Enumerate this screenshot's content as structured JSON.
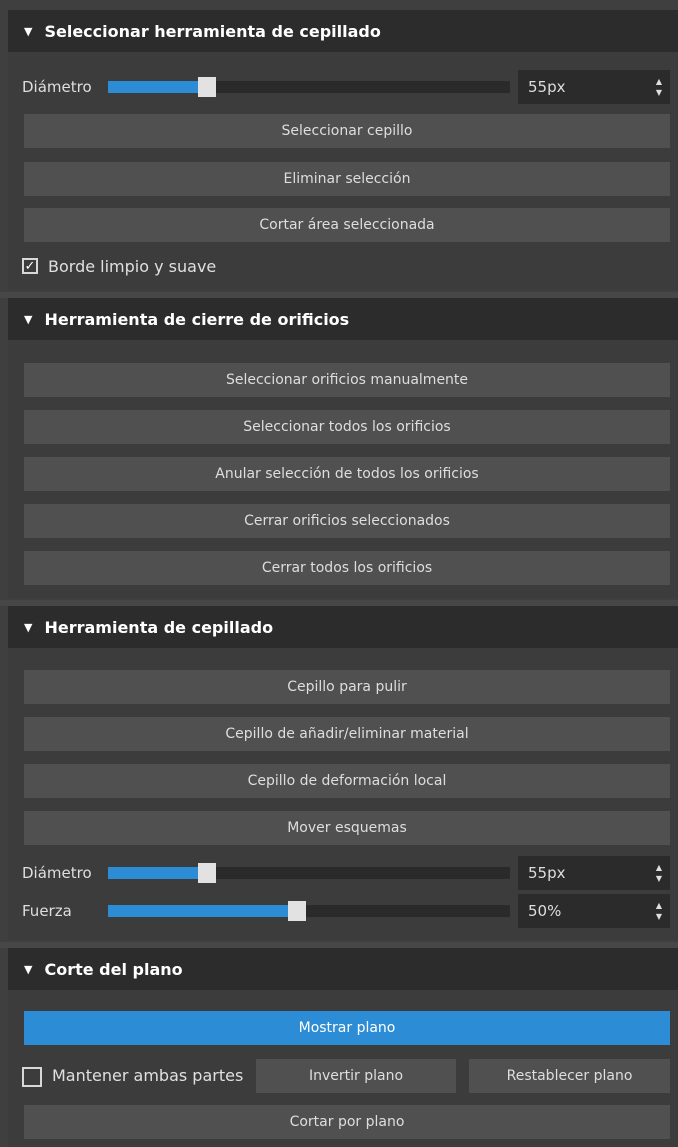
{
  "sections": {
    "select_brush": {
      "title": "Seleccionar herramienta de cepillado",
      "diameter_label": "Diámetro",
      "diameter_value": "55px",
      "diameter_fraction": 0.25,
      "buttons": [
        "Seleccionar cepillo",
        "Eliminar selección",
        "Cortar área seleccionada"
      ],
      "smooth_edge_label": "Borde limpio y suave",
      "smooth_edge_checked": true
    },
    "hole_fill": {
      "title": "Herramienta de cierre de orificios",
      "buttons": [
        "Seleccionar orificios manualmente",
        "Seleccionar todos los orificios",
        "Anular selección de todos los orificios",
        "Cerrar orificios seleccionados",
        "Cerrar todos los orificios"
      ]
    },
    "brush_tool": {
      "title": "Herramienta de cepillado",
      "buttons": [
        "Cepillo para pulir",
        "Cepillo de añadir/eliminar material",
        "Cepillo de deformación local",
        "Mover esquemas"
      ],
      "diameter_label": "Diámetro",
      "diameter_value": "55px",
      "diameter_fraction": 0.25,
      "strength_label": "Fuerza",
      "strength_value": "50%",
      "strength_fraction": 0.47
    },
    "plane_cut": {
      "title": "Corte del plano",
      "show_plane": "Mostrar plano",
      "keep_both_label": "Mantener ambas partes",
      "keep_both_checked": false,
      "invert_plane": "Invertir plano",
      "reset_plane": "Restablecer plano",
      "cut_by_plane": "Cortar por plano"
    }
  },
  "icons": {
    "collapse": "triangle-down-icon",
    "spin": "spin-arrows-icon",
    "check": "checkmark-icon"
  },
  "colors": {
    "accent": "#2c8dd6",
    "header_bg": "#2c2c2c",
    "button_bg": "#505050"
  }
}
